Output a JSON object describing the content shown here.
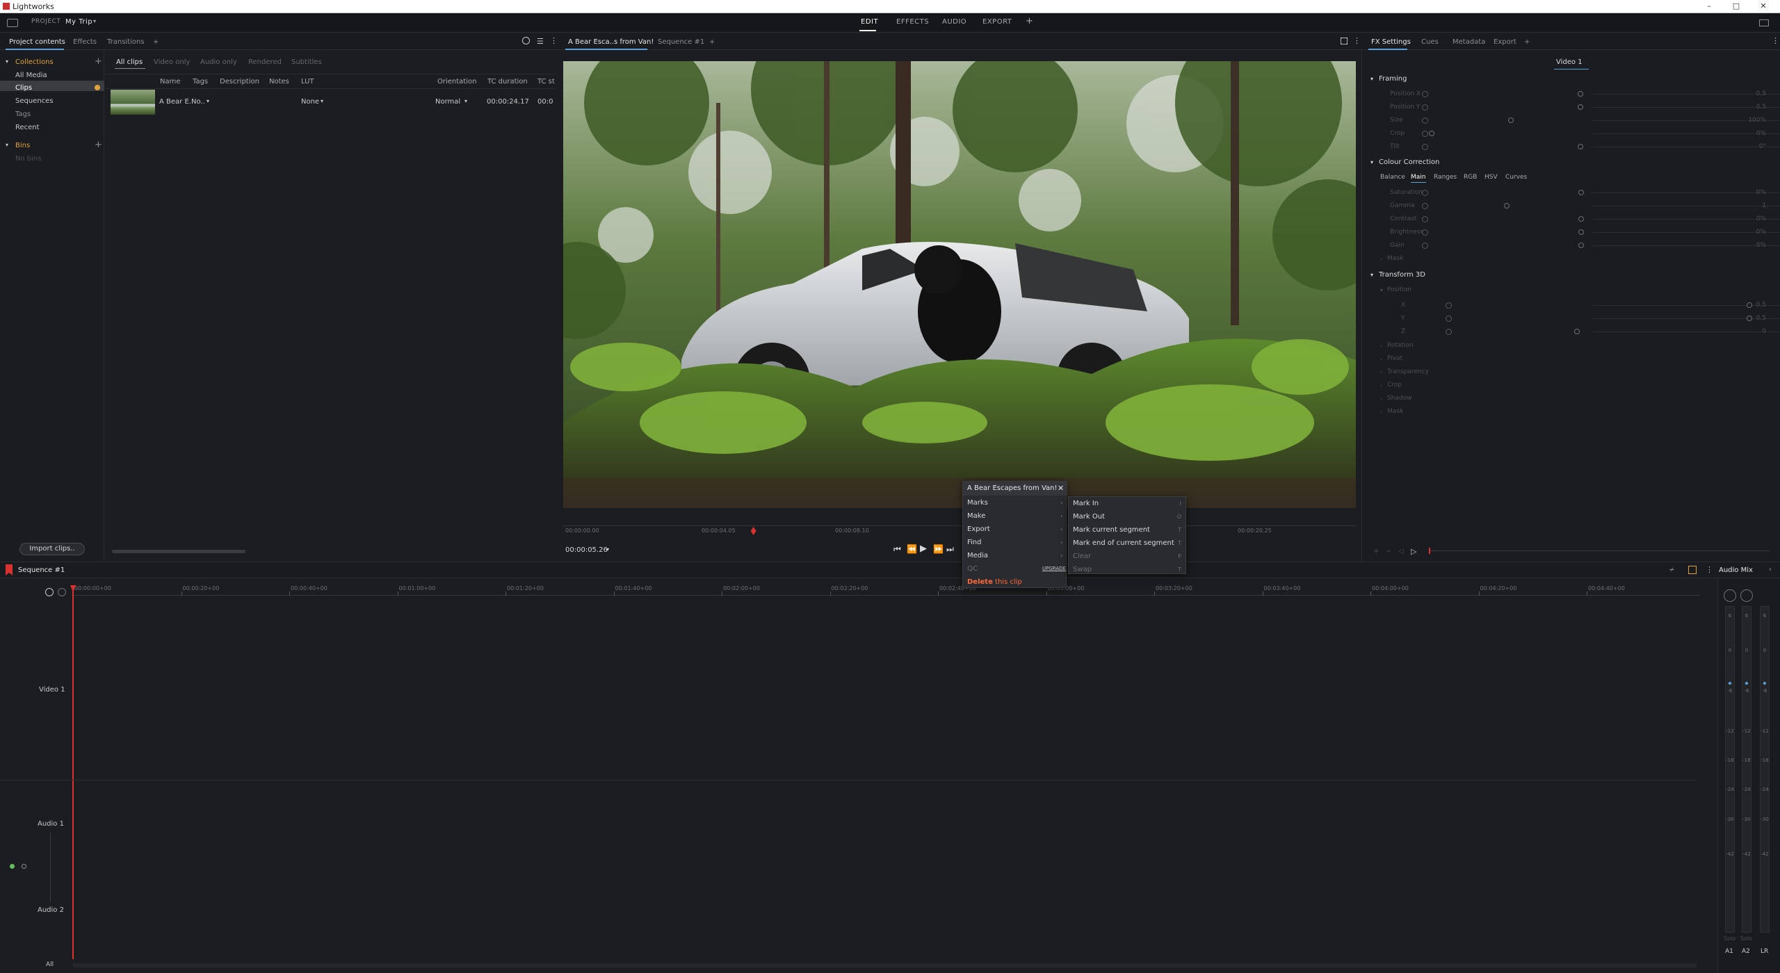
{
  "window": {
    "title": "Lightworks",
    "min": "–",
    "max": "□",
    "close": "✕"
  },
  "topbar": {
    "project_label": "PROJECT",
    "project_name": "My Trip",
    "rooms": [
      "EDIT",
      "EFFECTS",
      "AUDIO",
      "EXPORT"
    ],
    "add": "+",
    "active_room": "EDIT"
  },
  "left_tabs": [
    "Project contents",
    "Effects",
    "Transitions",
    "+"
  ],
  "collections": {
    "header": "Collections",
    "items": [
      "All Media",
      "Clips",
      "Sequences",
      "Tags",
      "Recent"
    ],
    "selected": "Clips"
  },
  "bins": {
    "header": "Bins",
    "empty": "No bins"
  },
  "import_button": "Import clips..",
  "clip_tabs": [
    "All clips",
    "Video only",
    "Audio only",
    "Rendered",
    "Subtitles"
  ],
  "clip_columns": [
    "Name",
    "Tags",
    "Description",
    "Notes",
    "LUT",
    "Orientation",
    "TC duration",
    "TC st"
  ],
  "clip_row": {
    "name": "A Bear E..",
    "tags": "No..",
    "lut": "None",
    "orientation": "Normal",
    "duration": "00:00:24.17",
    "start": "00:0"
  },
  "viewer_tabs": [
    "A Bear Esca..s from Van!",
    "Sequence #1",
    "+"
  ],
  "viewer": {
    "timecode": "00:00:05.26",
    "ruler": [
      "00:00:00.00",
      "00:00:04.05",
      "00:00:08.10",
      "00:00:20.25"
    ],
    "playhead_fraction": 0.24
  },
  "fx_tabs": [
    "FX Settings",
    "Cues",
    "Metadata",
    "Export",
    "+"
  ],
  "fx": {
    "track": "Video 1",
    "framing": {
      "title": "Framing",
      "params": [
        [
          "Position X",
          "0.5"
        ],
        [
          "Position Y",
          "0.5"
        ],
        [
          "Size",
          "100%"
        ],
        [
          "Crop",
          "0%"
        ],
        [
          "Tilt",
          "0°"
        ]
      ]
    },
    "colour": {
      "title": "Colour Correction",
      "tabs": [
        "Balance",
        "Main",
        "Ranges",
        "RGB",
        "HSV",
        "Curves"
      ],
      "active_tab": "Main",
      "params": [
        [
          "Saturation",
          "0%"
        ],
        [
          "Gamma",
          "1"
        ],
        [
          "Contrast",
          "0%"
        ],
        [
          "Brightness",
          "0%"
        ],
        [
          "Gain",
          "0%"
        ]
      ],
      "mask": "Mask"
    },
    "transform": {
      "title": "Transform 3D",
      "position": "Position",
      "params": [
        [
          "X",
          "0.5"
        ],
        [
          "Y",
          "0.5"
        ],
        [
          "Z",
          "0"
        ]
      ],
      "groups": [
        "Rotation",
        "Pivot",
        "Transparency",
        "Crop",
        "Shadow",
        "Mask"
      ]
    }
  },
  "sequence": {
    "name": "Sequence #1",
    "audio_mix": "Audio Mix"
  },
  "timeline": {
    "ruler": [
      "00:00:00+00",
      "00:00:20+00",
      "00:00:40+00",
      "00:01:00+00",
      "00:01:20+00",
      "00:01:40+00",
      "00:02:00+00",
      "00:02:20+00",
      "00:02:40+00",
      "00:03:00+00",
      "00:03:20+00",
      "00:03:40+00",
      "00:04:00+00",
      "00:04:20+00",
      "00:04:40+00"
    ],
    "tracks": [
      "Video 1",
      "Audio 1",
      "Audio 2"
    ],
    "all": "All"
  },
  "mixer": {
    "scale": [
      "6",
      "0",
      "-6",
      "-12",
      "-18",
      "-24",
      "-30",
      "-42"
    ],
    "solo": [
      "Solo",
      "Solo"
    ],
    "channels": [
      "A1",
      "A2",
      "LR"
    ]
  },
  "context_menu": {
    "header": "A Bear Escapes from Van!",
    "items": [
      "Marks",
      "Make",
      "Export",
      "Find",
      "Media",
      "QC"
    ],
    "upgrade": "UPGRADE",
    "delete_word": "Delete",
    "delete_rest": " this clip"
  },
  "submenu": {
    "items": [
      [
        "Mark In",
        "I"
      ],
      [
        "Mark Out",
        "O"
      ],
      [
        "Mark current segment",
        "T"
      ],
      [
        "Mark end of current segment",
        "T"
      ],
      [
        "Clear",
        "P"
      ],
      [
        "Swap",
        "T"
      ]
    ]
  },
  "colors": {
    "accent": "#5a9fd6",
    "orange": "#e0a23c",
    "red": "#d8312f"
  }
}
